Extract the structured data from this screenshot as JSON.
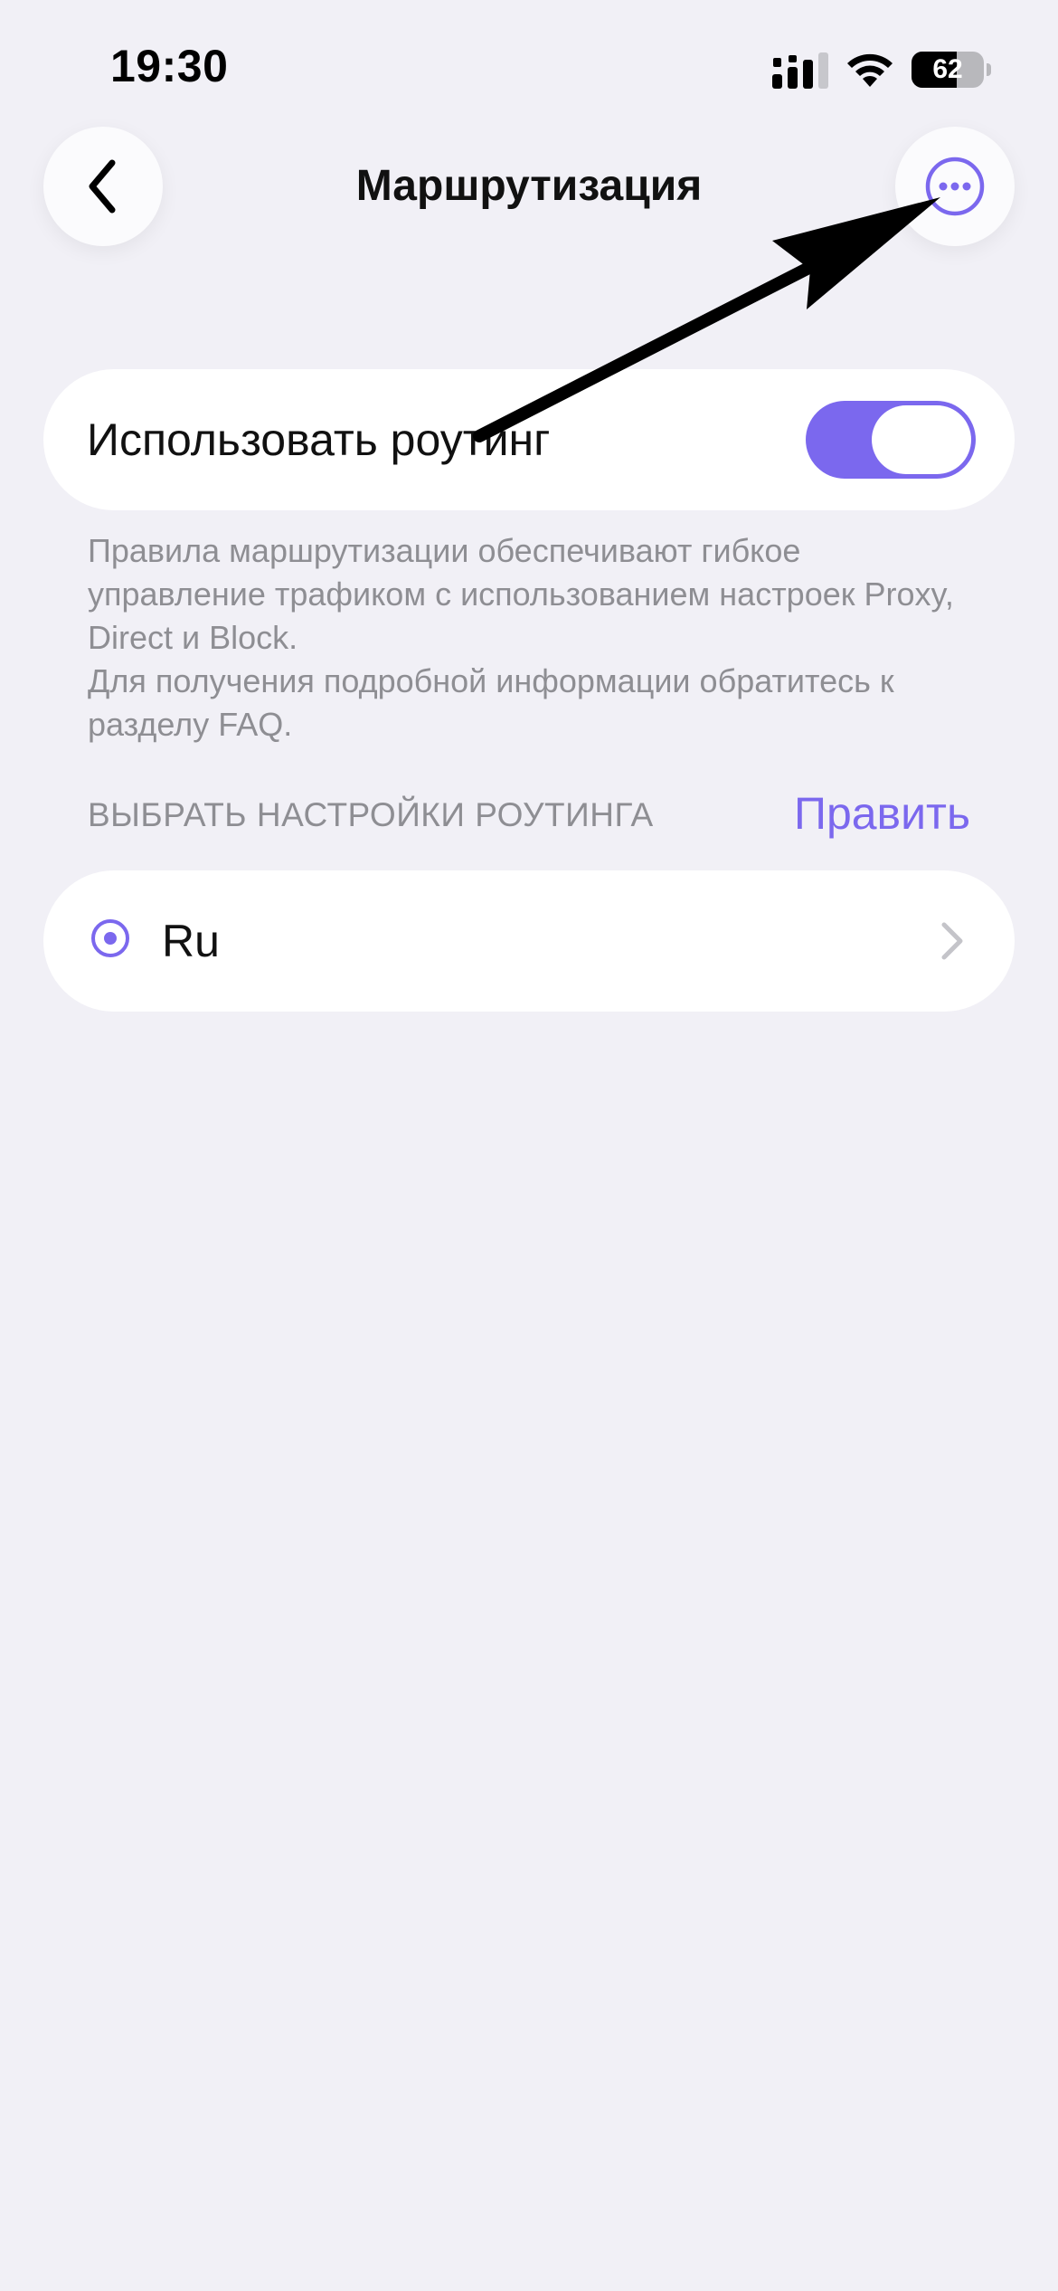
{
  "status_bar": {
    "time": "19:30",
    "battery_percent": 62,
    "icons": [
      "cellular-signal-icon",
      "wifi-icon",
      "battery-icon"
    ]
  },
  "header": {
    "title": "Маршрутизация",
    "back_icon": "chevron-left-icon",
    "more_icon": "ellipsis-circle-icon"
  },
  "routing_toggle": {
    "label": "Использовать роутинг",
    "enabled": true
  },
  "description": {
    "line1": "Правила маршрутизации обеспечивают гибкое управление трафиком с использованием настроек Proxy, Direct и Block.",
    "line2": "Для получения подробной информации обратитесь к разделу FAQ."
  },
  "routing_section": {
    "header": "ВЫБРАТЬ НАСТРОЙКИ РОУТИНГА",
    "edit_label": "Править",
    "items": [
      {
        "name": "Ru",
        "selected": true
      }
    ]
  },
  "colors": {
    "accent": "#7b68ee",
    "background": "#f1f0f6",
    "card": "#ffffff",
    "secondary_text": "#8e8e93"
  }
}
